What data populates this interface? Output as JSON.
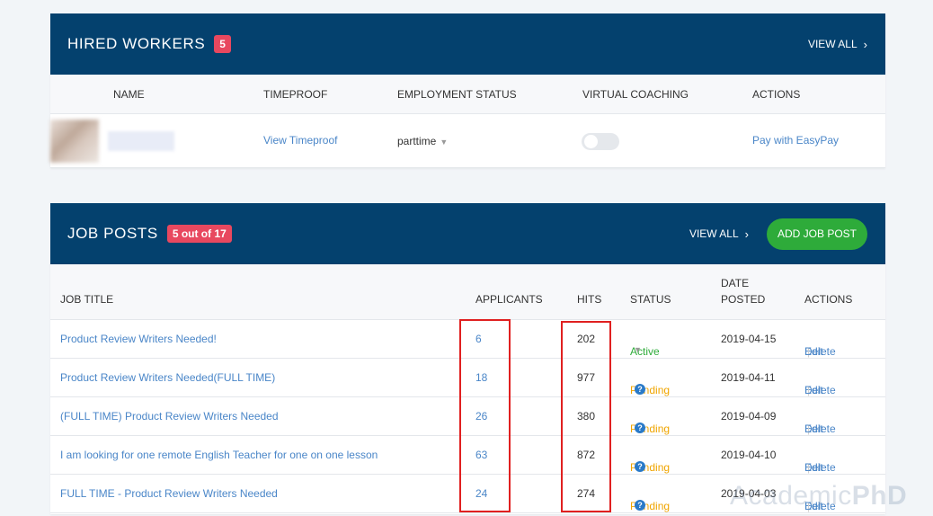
{
  "hired_workers": {
    "title": "HIRED WORKERS",
    "count_badge": "5",
    "view_all": "VIEW ALL",
    "columns": [
      "NAME",
      "TIMEPROOF",
      "EMPLOYMENT STATUS",
      "VIRTUAL COACHING",
      "ACTIONS"
    ],
    "rows": [
      {
        "timeproof": "View Timeproof",
        "employment_status": "parttime",
        "virtual_coaching": false,
        "action": "Pay with EasyPay"
      }
    ]
  },
  "job_posts": {
    "title": "JOB POSTS",
    "count_badge": "5 out of 17",
    "view_all": "VIEW ALL",
    "add_button": "ADD JOB POST",
    "columns": {
      "job_title": "JOB TITLE",
      "applicants": "APPLICANTS",
      "hits": "HITS",
      "status": "STATUS",
      "date_line1": "DATE",
      "date_line2": "POSTED",
      "actions": "ACTIONS"
    },
    "rows": [
      {
        "title": "Product Review Writers Needed!",
        "applicants": "6",
        "hits": "202",
        "status": "Active",
        "date": "2019-04-15",
        "edit": "Edit",
        "delete": "Delete"
      },
      {
        "title": "Product Review Writers Needed(FULL TIME)",
        "applicants": "18",
        "hits": "977",
        "status": "Pending",
        "date": "2019-04-11",
        "edit": "Edit",
        "delete": "Delete"
      },
      {
        "title": "(FULL TIME) Product Review Writers Needed",
        "applicants": "26",
        "hits": "380",
        "status": "Pending",
        "date": "2019-04-09",
        "edit": "Edit",
        "delete": "Delete"
      },
      {
        "title": "I am looking for one remote English Teacher for one on one lesson",
        "applicants": "63",
        "hits": "872",
        "status": "Pending",
        "date": "2019-04-10",
        "edit": "Edit",
        "delete": "Delete"
      },
      {
        "title": "FULL TIME - Product Review Writers Needed",
        "applicants": "24",
        "hits": "274",
        "status": "Pending",
        "date": "2019-04-03",
        "edit": "Edit",
        "delete": "Delete"
      }
    ]
  },
  "watermark": {
    "part1": "Academic",
    "part2": "PhD"
  },
  "colors": {
    "header_bg": "#04416e",
    "badge": "#e8485f",
    "add_button": "#2eab3a",
    "link": "#4a86c8",
    "active": "#2eab3a",
    "pending": "#f0a500",
    "highlight": "#e02020"
  }
}
